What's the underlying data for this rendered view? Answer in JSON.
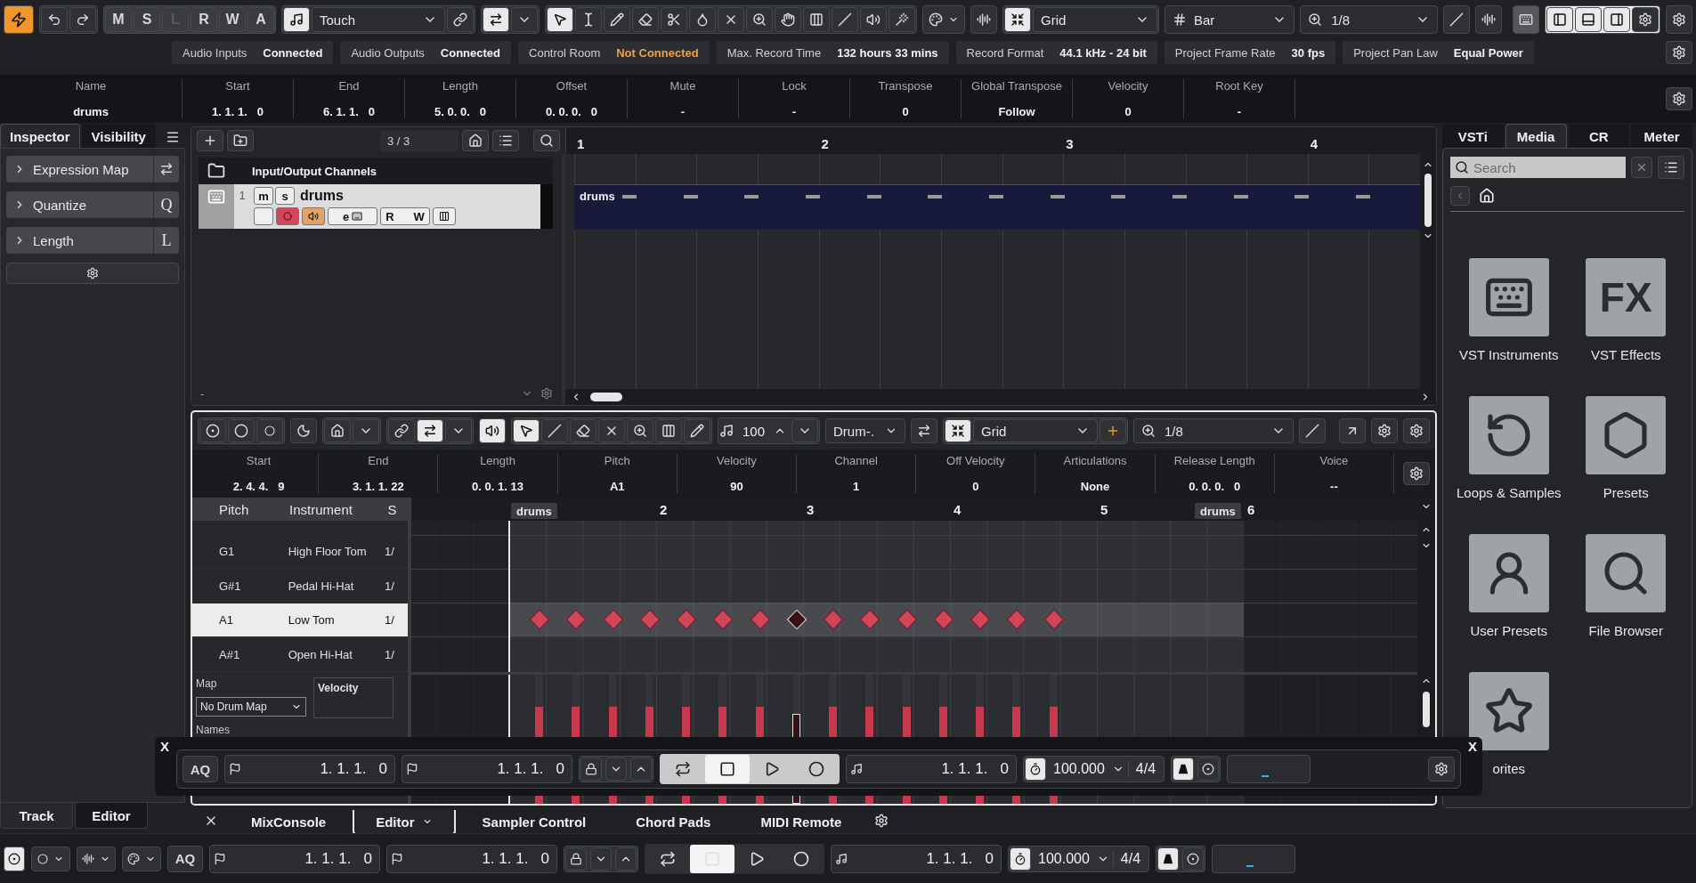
{
  "toolbar": {
    "automation_buttons": [
      {
        "label": "M",
        "disabled": false
      },
      {
        "label": "S",
        "disabled": false
      },
      {
        "label": "L",
        "disabled": true
      },
      {
        "label": "R",
        "disabled": false
      },
      {
        "label": "W",
        "disabled": false
      },
      {
        "label": "A",
        "disabled": false
      }
    ],
    "automation_mode": "Touch",
    "tools": [
      {
        "selected": true
      },
      {
        "selected": false
      },
      {
        "selected": false
      },
      {
        "selected": false
      },
      {
        "selected": false
      },
      {
        "selected": false
      },
      {
        "selected": false
      },
      {
        "selected": false
      },
      {
        "selected": false
      },
      {
        "selected": false
      },
      {
        "selected": false
      },
      {
        "selected": false
      },
      {
        "selected": false
      }
    ],
    "snap_type": "Grid",
    "grid_type": "Bar",
    "quantize": "1/8"
  },
  "status": [
    {
      "label": "Audio Inputs",
      "value": "Connected",
      "warning": false
    },
    {
      "label": "Audio Outputs",
      "value": "Connected",
      "warning": false
    },
    {
      "label": "Control Room",
      "value": "Not Connected",
      "warning": true
    },
    {
      "label": "Max. Record Time",
      "value": "132 hours 33 mins",
      "warning": false
    },
    {
      "label": "Record Format",
      "value": "44.1 kHz - 24 bit",
      "warning": false
    },
    {
      "label": "Project Frame Rate",
      "value": "30 fps",
      "warning": false
    },
    {
      "label": "Project Pan Law",
      "value": "Equal Power",
      "warning": false
    }
  ],
  "info_line": [
    {
      "label": "Name",
      "value": "drums"
    },
    {
      "label": "Start",
      "value": "1. 1. 1.   0"
    },
    {
      "label": "End",
      "value": "6. 1. 1.   0"
    },
    {
      "label": "Length",
      "value": "5. 0. 0.   0"
    },
    {
      "label": "Offset",
      "value": "0. 0. 0.   0"
    },
    {
      "label": "Mute",
      "value": "-"
    },
    {
      "label": "Lock",
      "value": "-"
    },
    {
      "label": "Transpose",
      "value": "0"
    },
    {
      "label": "Global Transpose",
      "value": "Follow"
    },
    {
      "label": "Velocity",
      "value": "0"
    },
    {
      "label": "Root Key",
      "value": "-"
    }
  ],
  "inspector": {
    "tabs": [
      {
        "label": "Inspector",
        "selected": true
      },
      {
        "label": "Visibility",
        "selected": false
      }
    ],
    "sections": [
      {
        "label": "Expression Map",
        "expanded": false
      },
      {
        "label": "Quantize",
        "expanded": false,
        "shortcut": "Q"
      },
      {
        "label": "Length",
        "expanded": false,
        "shortcut": "L"
      }
    ]
  },
  "project": {
    "track_count": "3 / 3",
    "folder_track": "Input/Output Channels",
    "track": {
      "number": "1",
      "name": "drums",
      "selected": true,
      "buttons": [
        "m",
        "s"
      ],
      "record": true,
      "monitor": true,
      "edit_button": "e",
      "rw_buttons": [
        "R",
        "W"
      ]
    },
    "ruler": [
      "1",
      "2",
      "3",
      "4"
    ],
    "part": "drums",
    "footer": "-"
  },
  "lower_zone": {
    "toolbar": {
      "tools": [
        {
          "selected": true
        },
        {
          "selected": false
        },
        {
          "selected": false
        },
        {
          "selected": false
        },
        {
          "selected": false
        },
        {
          "selected": false
        },
        {
          "selected": false
        }
      ],
      "velocity": "100",
      "drum_map": "Drum-.",
      "snap_type": "Grid",
      "quantize": "1/8"
    },
    "info_line": [
      {
        "label": "Start",
        "value": "2. 4. 4.   9"
      },
      {
        "label": "End",
        "value": "3. 1. 1. 22"
      },
      {
        "label": "Length",
        "value": "0. 0. 1. 13"
      },
      {
        "label": "Pitch",
        "value": "A1"
      },
      {
        "label": "Velocity",
        "value": "90"
      },
      {
        "label": "Channel",
        "value": "1"
      },
      {
        "label": "Off Velocity",
        "value": "0"
      },
      {
        "label": "Articulations",
        "value": "None"
      },
      {
        "label": "Release Length",
        "value": "0. 0. 0.   0"
      },
      {
        "label": "Voice",
        "value": "--"
      }
    ],
    "columns": [
      "Pitch",
      "Instrument",
      "S"
    ],
    "rows": [
      {
        "pitch": "G1",
        "instrument": "High Floor Tom",
        "column_3": "1/",
        "selected": false
      },
      {
        "pitch": "G#1",
        "instrument": "Pedal Hi-Hat",
        "column_3": "1/",
        "selected": false
      },
      {
        "pitch": "A1",
        "instrument": "Low Tom",
        "column_3": "1/",
        "selected": true,
        "notes": [
          {
            "selected": false
          },
          {
            "selected": false
          },
          {
            "selected": false
          },
          {
            "selected": false
          },
          {
            "selected": false
          },
          {
            "selected": false
          },
          {
            "selected": false
          },
          {
            "selected": true
          },
          {
            "selected": false
          },
          {
            "selected": false
          },
          {
            "selected": false
          },
          {
            "selected": false
          },
          {
            "selected": false
          },
          {
            "selected": false
          },
          {
            "selected": false
          }
        ]
      },
      {
        "pitch": "A#1",
        "instrument": "Open Hi-Hat",
        "column_3": "1/",
        "selected": false
      }
    ],
    "ruler": {
      "start_label": "drums",
      "end_label": "drums",
      "bars": [
        "2",
        "3",
        "4",
        "5",
        "6"
      ]
    },
    "map_label": "Map",
    "map": "No Drum Map",
    "names_label": "Names",
    "velocity_lane": {
      "label": "Velocity",
      "bars": [
        {
          "level": 0.75,
          "selected": false
        },
        {
          "level": 0.75,
          "selected": false
        },
        {
          "level": 0.75,
          "selected": false
        },
        {
          "level": 0.75,
          "selected": false
        },
        {
          "level": 0.75,
          "selected": false
        },
        {
          "level": 0.75,
          "selected": false
        },
        {
          "level": 0.75,
          "selected": false
        },
        {
          "level": 0.7,
          "selected": true
        },
        {
          "level": 0.75,
          "selected": false
        },
        {
          "level": 0.75,
          "selected": false
        },
        {
          "level": 0.75,
          "selected": false
        },
        {
          "level": 0.75,
          "selected": false
        },
        {
          "level": 0.75,
          "selected": false
        },
        {
          "level": 0.75,
          "selected": false
        },
        {
          "level": 0.75,
          "selected": false
        }
      ]
    }
  },
  "left_zone_tabs": [
    {
      "label": "Track",
      "selected": true
    },
    {
      "label": "Editor",
      "selected": false
    }
  ],
  "lower_zone_tabs": [
    {
      "label": "MixConsole",
      "selected": false
    },
    {
      "label": "Editor",
      "selected": true
    },
    {
      "label": "Sampler Control",
      "selected": false
    },
    {
      "label": "Chord Pads",
      "selected": false
    },
    {
      "label": "MIDI Remote",
      "selected": false
    }
  ],
  "media_panel": {
    "tabs": [
      {
        "label": "VSTi",
        "selected": false
      },
      {
        "label": "Media",
        "selected": true
      },
      {
        "label": "CR",
        "selected": false
      },
      {
        "label": "Meter",
        "selected": false
      }
    ],
    "search": {
      "placeholder": "Search"
    },
    "fx_icon_text": "FX",
    "tiles": [
      {
        "label": "VST Instruments"
      },
      {
        "label": "VST Effects"
      },
      {
        "label": "Loops & Samples"
      },
      {
        "label": "Presets"
      },
      {
        "label": "User Presets"
      },
      {
        "label": "File Browser"
      },
      {
        "label": "orites"
      }
    ]
  },
  "transport_overlay": {
    "close_left": "X",
    "close_right": "X",
    "quantize": "AQ",
    "left_locator": "1. 1. 1.   0",
    "right_locator": "1. 1. 1.   0",
    "controls": [
      {
        "selected": false
      },
      {
        "selected": true
      },
      {
        "selected": false
      },
      {
        "selected": false
      }
    ],
    "position": "1. 1. 1.   0",
    "tempo": "100.000",
    "signature": "4/4"
  },
  "transport_bar": {
    "quantize": "AQ",
    "left_locator": "1. 1. 1.   0",
    "right_locator": "1. 1. 1.   0",
    "controls": [
      {
        "selected": false
      },
      {
        "selected": true
      },
      {
        "selected": false
      },
      {
        "selected": false
      }
    ],
    "position": "1. 1. 1.   0",
    "tempo": "100.000",
    "signature": "4/4"
  }
}
